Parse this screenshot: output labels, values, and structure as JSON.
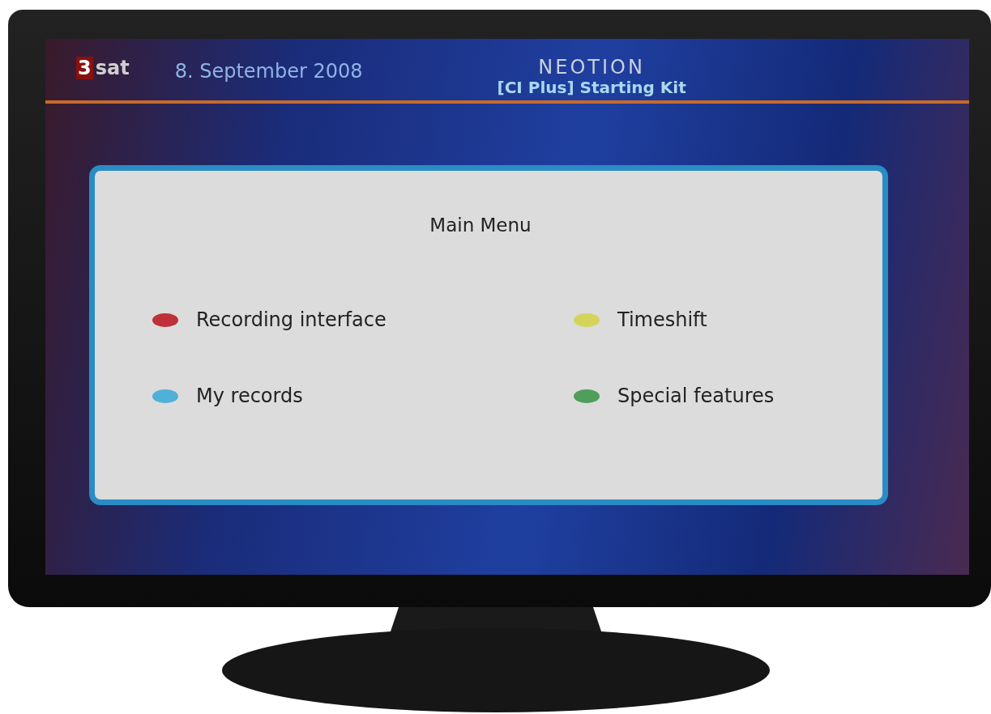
{
  "screen_header": {
    "channel_logo": {
      "number": "3",
      "name": "sat"
    },
    "date": "8. September 2008",
    "brand": "NEOTION",
    "subtitle": "[CI Plus] Starting Kit"
  },
  "menu": {
    "title": "Main Menu",
    "items": [
      {
        "label": "Recording interface",
        "color": "#c0303a"
      },
      {
        "label": "Timeshift",
        "color": "#d4d45a"
      },
      {
        "label": "My records",
        "color": "#4fb0d8"
      },
      {
        "label": "Special features",
        "color": "#4f9e5c"
      }
    ]
  }
}
